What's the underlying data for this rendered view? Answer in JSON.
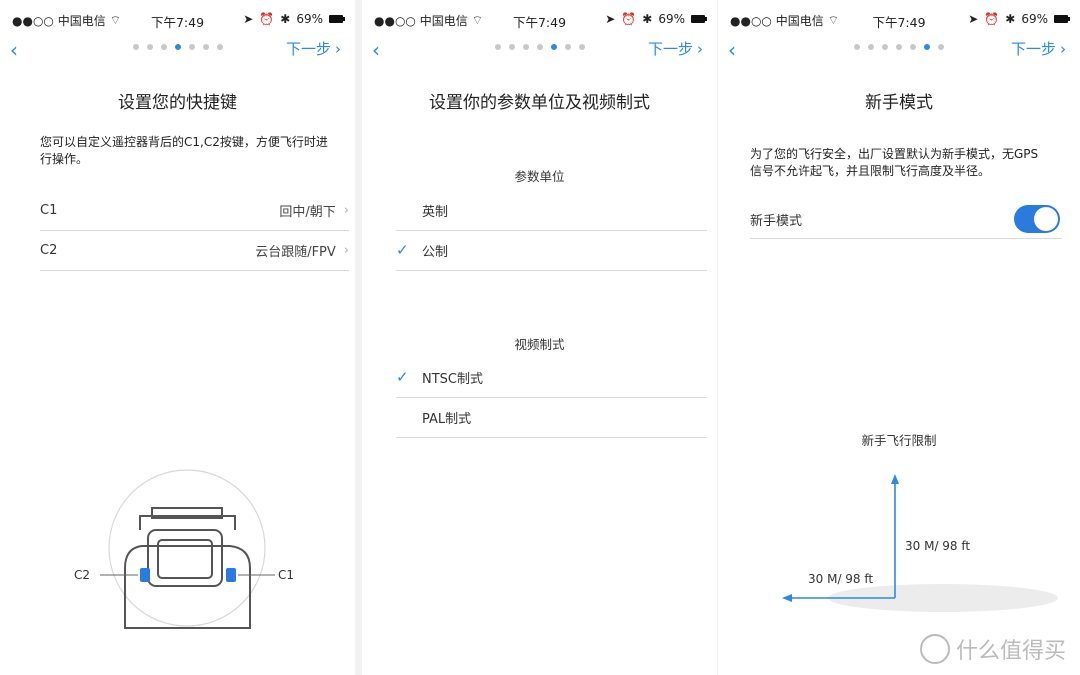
{
  "status": {
    "carrier": "●●○○ 中国电信",
    "time": "下午7:49",
    "battery": "69%"
  },
  "nav": {
    "back_label": "‹",
    "next_label": "下一步",
    "dots": 7
  },
  "panel1": {
    "title": "设置您的快捷键",
    "description": "您可以自定义遥控器背后的C1,C2按键，方便飞行时进行操作。",
    "rows": [
      {
        "key": "C1",
        "value": "回中/朝下"
      },
      {
        "key": "C2",
        "value": "云台跟随/FPV"
      }
    ],
    "diagram": {
      "left_label": "C2",
      "right_label": "C1"
    }
  },
  "panel2": {
    "title": "设置你的参数单位及视频制式",
    "units_header": "参数单位",
    "units": [
      {
        "label": "英制",
        "checked": false
      },
      {
        "label": "公制",
        "checked": true
      }
    ],
    "video_header": "视频制式",
    "video": [
      {
        "label": "NTSC制式",
        "checked": true
      },
      {
        "label": "PAL制式",
        "checked": false
      }
    ]
  },
  "panel3": {
    "title": "新手模式",
    "description": "为了您的飞行安全，出厂设置默认为新手模式，无GPS信号不允许起飞，并且限制飞行高度及半径。",
    "mode_label": "新手模式",
    "toggle_on": true,
    "limit_title": "新手飞行限制",
    "height_label": "30 M/ 98 ft",
    "radius_label": "30 M/ 98 ft"
  },
  "watermark": "什么值得买",
  "colors": {
    "accent": "#2b8ae2",
    "toggle": "#2b7bdf"
  }
}
